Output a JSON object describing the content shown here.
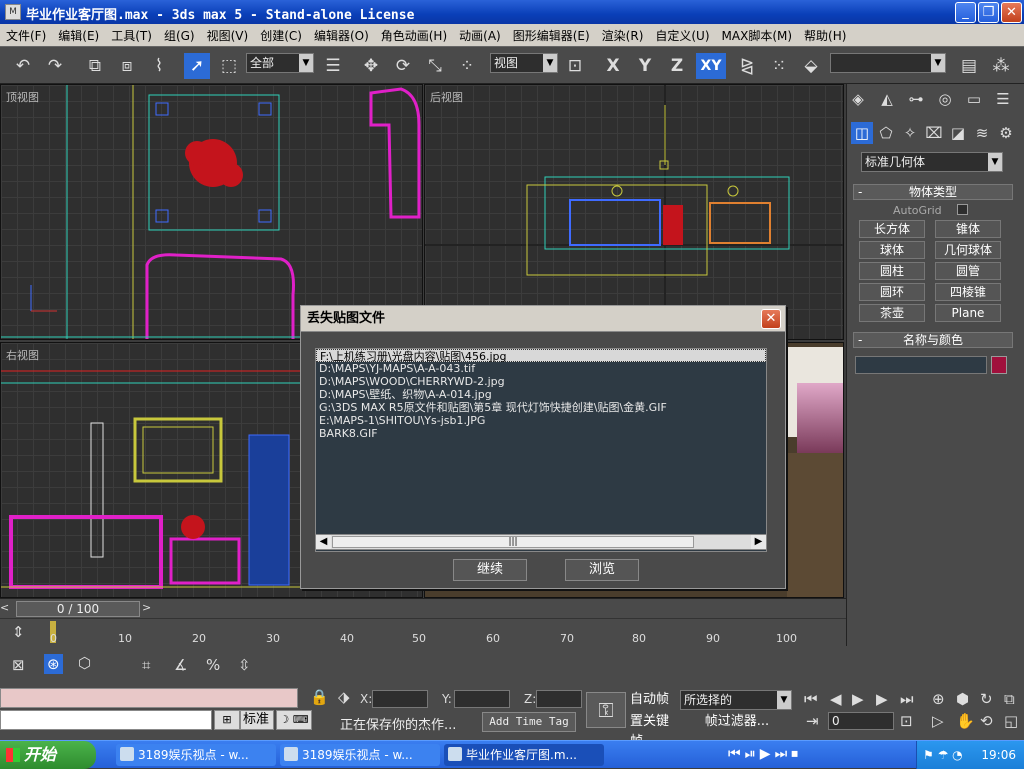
{
  "window": {
    "title": "毕业作业客厅图.max - 3ds max 5 - Stand-alone License",
    "icon_label": "M"
  },
  "menu": [
    "文件(F)",
    "编辑(E)",
    "工具(T)",
    "组(G)",
    "视图(V)",
    "创建(C)",
    "编辑器(O)",
    "角色动画(H)",
    "动画(A)",
    "图形编辑器(E)",
    "渲染(R)",
    "自定义(U)",
    "MAX脚本(M)",
    "帮助(H)"
  ],
  "toolbar": {
    "selection_filter": "全部",
    "ref_coord": "视图",
    "axis_x": "X",
    "axis_y": "Y",
    "axis_z": "Z",
    "axis_xy": "XY",
    "named_selection": ""
  },
  "viewports": {
    "top": "顶视图",
    "front": "后视图",
    "left": "右视图"
  },
  "command_panel": {
    "category": "标准几何体",
    "object_type_header": "物体类型",
    "autogrid": "AutoGrid",
    "buttons": [
      "长方体",
      "锥体",
      "球体",
      "几何球体",
      "圆柱",
      "圆管",
      "圆环",
      "四棱锥",
      "茶壶",
      "Plane"
    ],
    "name_color_header": "名称与颜色",
    "object_name": "",
    "object_color": "#a0103c",
    "rollout_toggle": "-"
  },
  "dialog": {
    "title": "丢失贴图文件",
    "files": [
      "F:\\上机练习册\\光盘内容\\贴图\\456.jpg",
      "D:\\MAPS\\YJ-MAPS\\A-A-043.tif",
      "D:\\MAPS\\WOOD\\CHERRYWD-2.jpg",
      "D:\\MAPS\\壁纸、织物\\A-A-014.jpg",
      "G:\\3DS MAX R5原文件和贴图\\第5章 现代灯饰快捷创建\\贴图\\金黄.GIF",
      "E:\\MAPS-1\\SHITOU\\Ys-jsb1.JPG",
      "BARK8.GIF"
    ],
    "continue": "继续",
    "browse": "浏览",
    "scroll_grip": "|||"
  },
  "timeline": {
    "frame_display": "0 / 100",
    "ticks": [
      "0",
      "10",
      "20",
      "30",
      "40",
      "50",
      "60",
      "70",
      "80",
      "90",
      "100"
    ]
  },
  "status": {
    "lock_label": "标准",
    "x_label": "X:",
    "y_label": "Y:",
    "z_label": "Z:",
    "x_value": "",
    "y_value": "",
    "z_value": "",
    "prompt": "正在保存你的杰作...",
    "add_time_tag": "Add Time Tag",
    "auto_key": "自动帧",
    "set_key": "置关键帧",
    "selection_mode": "所选择的",
    "key_filters": "帧过滤器...",
    "current_frame": "0"
  },
  "taskbar": {
    "start": "开始",
    "tasks": [
      "3189娱乐视点 - w...",
      "3189娱乐视点 - w...",
      "毕业作业客厅图.m..."
    ],
    "clock": "19:06"
  }
}
